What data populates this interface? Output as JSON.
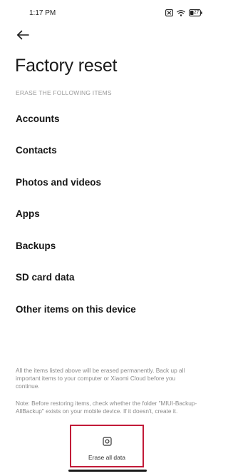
{
  "status_bar": {
    "time": "1:17 PM",
    "battery_level": "27",
    "icons": [
      "sim-blocked-icon",
      "wifi-icon",
      "battery-icon"
    ]
  },
  "header": {
    "back_icon": "arrow-left-icon",
    "title": "Factory reset"
  },
  "section": {
    "header": "ERASE THE FOLLOWING ITEMS",
    "items": [
      {
        "label": "Accounts"
      },
      {
        "label": "Contacts"
      },
      {
        "label": "Photos and videos"
      },
      {
        "label": "Apps"
      },
      {
        "label": "Backups"
      },
      {
        "label": "SD card data"
      },
      {
        "label": "Other items on this device"
      }
    ]
  },
  "notices": {
    "permanent": "All the items listed above will be erased permanently. Back up all important items to your computer or Xiaomi Cloud before you continue.",
    "restore": "Note: Before restoring items, check whether the folder \"MIUI-Backup-AllBackup\" exists on your mobile device. If it doesn't, create it."
  },
  "action": {
    "icon": "erase-phone-icon",
    "label": "Erase all data"
  },
  "colors": {
    "highlight_border": "#c21a38",
    "text_primary": "#161616",
    "text_secondary": "#8a8a8a"
  }
}
